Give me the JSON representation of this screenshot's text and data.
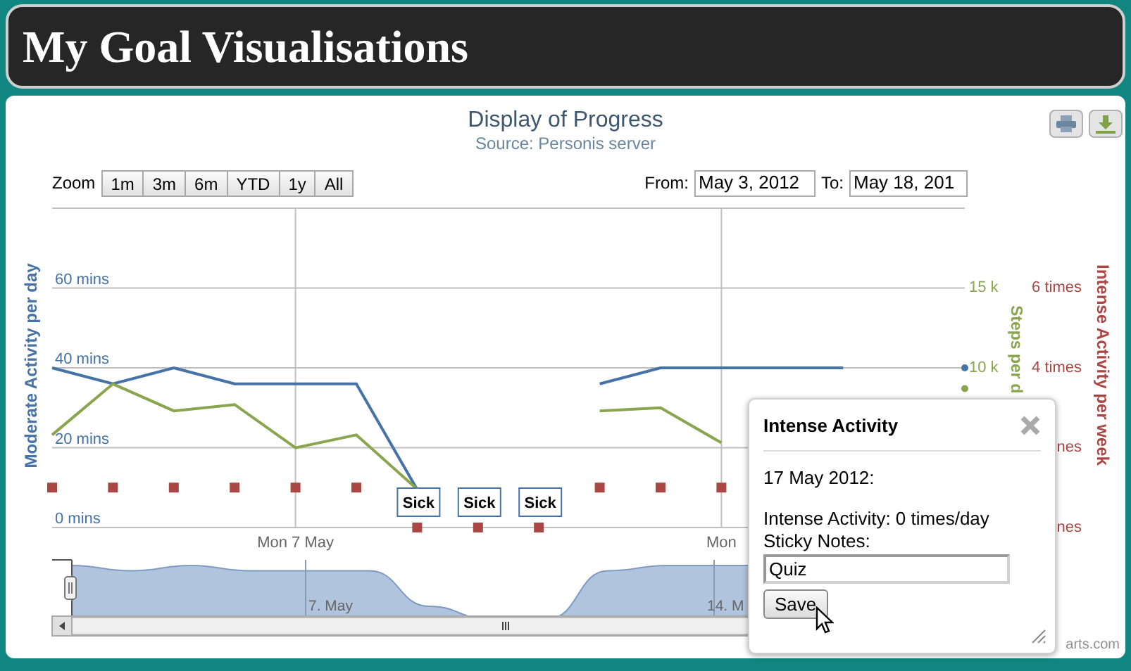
{
  "header": {
    "title": "My Goal Visualisations"
  },
  "chart": {
    "title": "Display of Progress",
    "subtitle": "Source: Personis server",
    "range_selector": {
      "label": "Zoom",
      "buttons": [
        {
          "label": "1m",
          "selected": false
        },
        {
          "label": "3m",
          "selected": false
        },
        {
          "label": "6m",
          "selected": false
        },
        {
          "label": "YTD",
          "selected": false
        },
        {
          "label": "1y",
          "selected": false
        },
        {
          "label": "All",
          "selected": false
        }
      ],
      "from_label": "From:",
      "from_value": "May 3, 2012",
      "to_label": "To:",
      "to_value": "May 18, 201"
    },
    "chart_data": {
      "type": "line",
      "ylabel": "Moderate Activity per day",
      "categories": [
        null,
        null,
        null,
        null,
        "Mon 7 May",
        null,
        null,
        null,
        null,
        null,
        null,
        "Mon",
        null,
        null,
        null,
        null
      ],
      "ylim": [
        0,
        80
      ],
      "yticks": [
        {
          "value": 0,
          "label": "0 mins"
        },
        {
          "value": 20,
          "label": "20 mins"
        },
        {
          "value": 40,
          "label": "40 mins"
        },
        {
          "value": 60,
          "label": "60 mins"
        }
      ],
      "grid": true,
      "y2lim": [
        0,
        20
      ],
      "y3lim": [
        0,
        8
      ],
      "y2label": "Steps per d",
      "y2ticks": [
        {
          "value": 10,
          "label": "10 k"
        },
        {
          "value": 15,
          "label": "15 k"
        }
      ],
      "y3label": "Intense Activity per week",
      "y3ticks": [
        {
          "value": 0,
          "label": "nes"
        },
        {
          "value": 2,
          "label": "nes"
        },
        {
          "value": 4,
          "label": "4 times"
        },
        {
          "value": 6,
          "label": "6 times"
        }
      ],
      "series": [
        {
          "color": "#4572a7",
          "type": "line",
          "values": [
            40,
            36,
            40,
            36,
            36,
            36,
            9.5,
            null,
            null,
            36,
            40,
            40,
            40,
            40,
            null,
            40
          ]
        },
        {
          "color": "#89a54e",
          "type": "line",
          "axis": "y2",
          "values": [
            5.8,
            9.0,
            7.3,
            7.7,
            5.0,
            5.8,
            2.4,
            null,
            null,
            7.3,
            7.5,
            5.3,
            null,
            null,
            null,
            8.7
          ]
        },
        {
          "color": "#aa4643",
          "type": "scatter",
          "axis": "y3",
          "values": [
            1,
            1,
            1,
            1,
            1,
            1,
            0,
            0,
            0,
            1,
            1,
            1,
            null,
            null,
            null,
            null
          ]
        }
      ],
      "annotations": [
        "Sick",
        "Sick",
        "Sick"
      ]
    },
    "navigator": {
      "labels": [
        "7. May",
        "14. M"
      ]
    },
    "credit": "arts.com",
    "tooltip": {
      "title": "Intense Activity",
      "date": "17 May 2012:",
      "detail": "Intense Activity: 0 times/day",
      "notes_label": "Sticky Notes:",
      "notes_value": "Quiz",
      "save_button": "Save"
    }
  }
}
